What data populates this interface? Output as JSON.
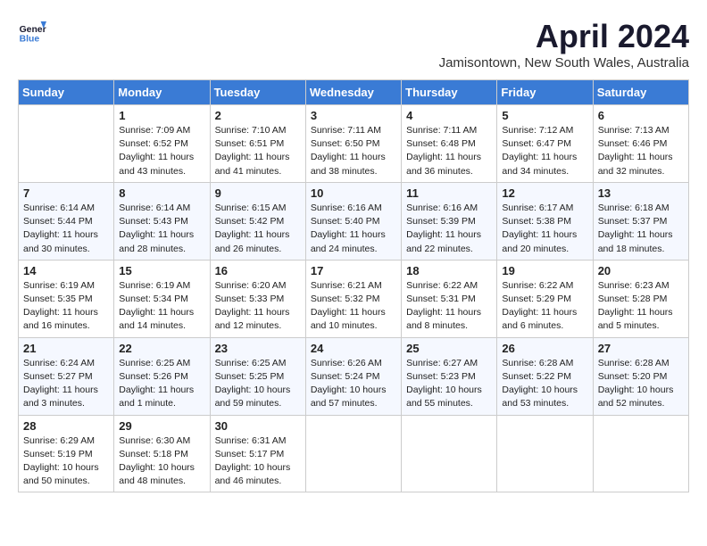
{
  "logo": {
    "line1": "General",
    "line2": "Blue"
  },
  "title": "April 2024",
  "location": "Jamisontown, New South Wales, Australia",
  "days_of_week": [
    "Sunday",
    "Monday",
    "Tuesday",
    "Wednesday",
    "Thursday",
    "Friday",
    "Saturday"
  ],
  "weeks": [
    [
      {
        "day": "",
        "info": ""
      },
      {
        "day": "1",
        "info": "Sunrise: 7:09 AM\nSunset: 6:52 PM\nDaylight: 11 hours\nand 43 minutes."
      },
      {
        "day": "2",
        "info": "Sunrise: 7:10 AM\nSunset: 6:51 PM\nDaylight: 11 hours\nand 41 minutes."
      },
      {
        "day": "3",
        "info": "Sunrise: 7:11 AM\nSunset: 6:50 PM\nDaylight: 11 hours\nand 38 minutes."
      },
      {
        "day": "4",
        "info": "Sunrise: 7:11 AM\nSunset: 6:48 PM\nDaylight: 11 hours\nand 36 minutes."
      },
      {
        "day": "5",
        "info": "Sunrise: 7:12 AM\nSunset: 6:47 PM\nDaylight: 11 hours\nand 34 minutes."
      },
      {
        "day": "6",
        "info": "Sunrise: 7:13 AM\nSunset: 6:46 PM\nDaylight: 11 hours\nand 32 minutes."
      }
    ],
    [
      {
        "day": "7",
        "info": "Sunrise: 6:14 AM\nSunset: 5:44 PM\nDaylight: 11 hours\nand 30 minutes."
      },
      {
        "day": "8",
        "info": "Sunrise: 6:14 AM\nSunset: 5:43 PM\nDaylight: 11 hours\nand 28 minutes."
      },
      {
        "day": "9",
        "info": "Sunrise: 6:15 AM\nSunset: 5:42 PM\nDaylight: 11 hours\nand 26 minutes."
      },
      {
        "day": "10",
        "info": "Sunrise: 6:16 AM\nSunset: 5:40 PM\nDaylight: 11 hours\nand 24 minutes."
      },
      {
        "day": "11",
        "info": "Sunrise: 6:16 AM\nSunset: 5:39 PM\nDaylight: 11 hours\nand 22 minutes."
      },
      {
        "day": "12",
        "info": "Sunrise: 6:17 AM\nSunset: 5:38 PM\nDaylight: 11 hours\nand 20 minutes."
      },
      {
        "day": "13",
        "info": "Sunrise: 6:18 AM\nSunset: 5:37 PM\nDaylight: 11 hours\nand 18 minutes."
      }
    ],
    [
      {
        "day": "14",
        "info": "Sunrise: 6:19 AM\nSunset: 5:35 PM\nDaylight: 11 hours\nand 16 minutes."
      },
      {
        "day": "15",
        "info": "Sunrise: 6:19 AM\nSunset: 5:34 PM\nDaylight: 11 hours\nand 14 minutes."
      },
      {
        "day": "16",
        "info": "Sunrise: 6:20 AM\nSunset: 5:33 PM\nDaylight: 11 hours\nand 12 minutes."
      },
      {
        "day": "17",
        "info": "Sunrise: 6:21 AM\nSunset: 5:32 PM\nDaylight: 11 hours\nand 10 minutes."
      },
      {
        "day": "18",
        "info": "Sunrise: 6:22 AM\nSunset: 5:31 PM\nDaylight: 11 hours\nand 8 minutes."
      },
      {
        "day": "19",
        "info": "Sunrise: 6:22 AM\nSunset: 5:29 PM\nDaylight: 11 hours\nand 6 minutes."
      },
      {
        "day": "20",
        "info": "Sunrise: 6:23 AM\nSunset: 5:28 PM\nDaylight: 11 hours\nand 5 minutes."
      }
    ],
    [
      {
        "day": "21",
        "info": "Sunrise: 6:24 AM\nSunset: 5:27 PM\nDaylight: 11 hours\nand 3 minutes."
      },
      {
        "day": "22",
        "info": "Sunrise: 6:25 AM\nSunset: 5:26 PM\nDaylight: 11 hours\nand 1 minute."
      },
      {
        "day": "23",
        "info": "Sunrise: 6:25 AM\nSunset: 5:25 PM\nDaylight: 10 hours\nand 59 minutes."
      },
      {
        "day": "24",
        "info": "Sunrise: 6:26 AM\nSunset: 5:24 PM\nDaylight: 10 hours\nand 57 minutes."
      },
      {
        "day": "25",
        "info": "Sunrise: 6:27 AM\nSunset: 5:23 PM\nDaylight: 10 hours\nand 55 minutes."
      },
      {
        "day": "26",
        "info": "Sunrise: 6:28 AM\nSunset: 5:22 PM\nDaylight: 10 hours\nand 53 minutes."
      },
      {
        "day": "27",
        "info": "Sunrise: 6:28 AM\nSunset: 5:20 PM\nDaylight: 10 hours\nand 52 minutes."
      }
    ],
    [
      {
        "day": "28",
        "info": "Sunrise: 6:29 AM\nSunset: 5:19 PM\nDaylight: 10 hours\nand 50 minutes."
      },
      {
        "day": "29",
        "info": "Sunrise: 6:30 AM\nSunset: 5:18 PM\nDaylight: 10 hours\nand 48 minutes."
      },
      {
        "day": "30",
        "info": "Sunrise: 6:31 AM\nSunset: 5:17 PM\nDaylight: 10 hours\nand 46 minutes."
      },
      {
        "day": "",
        "info": ""
      },
      {
        "day": "",
        "info": ""
      },
      {
        "day": "",
        "info": ""
      },
      {
        "day": "",
        "info": ""
      }
    ]
  ]
}
